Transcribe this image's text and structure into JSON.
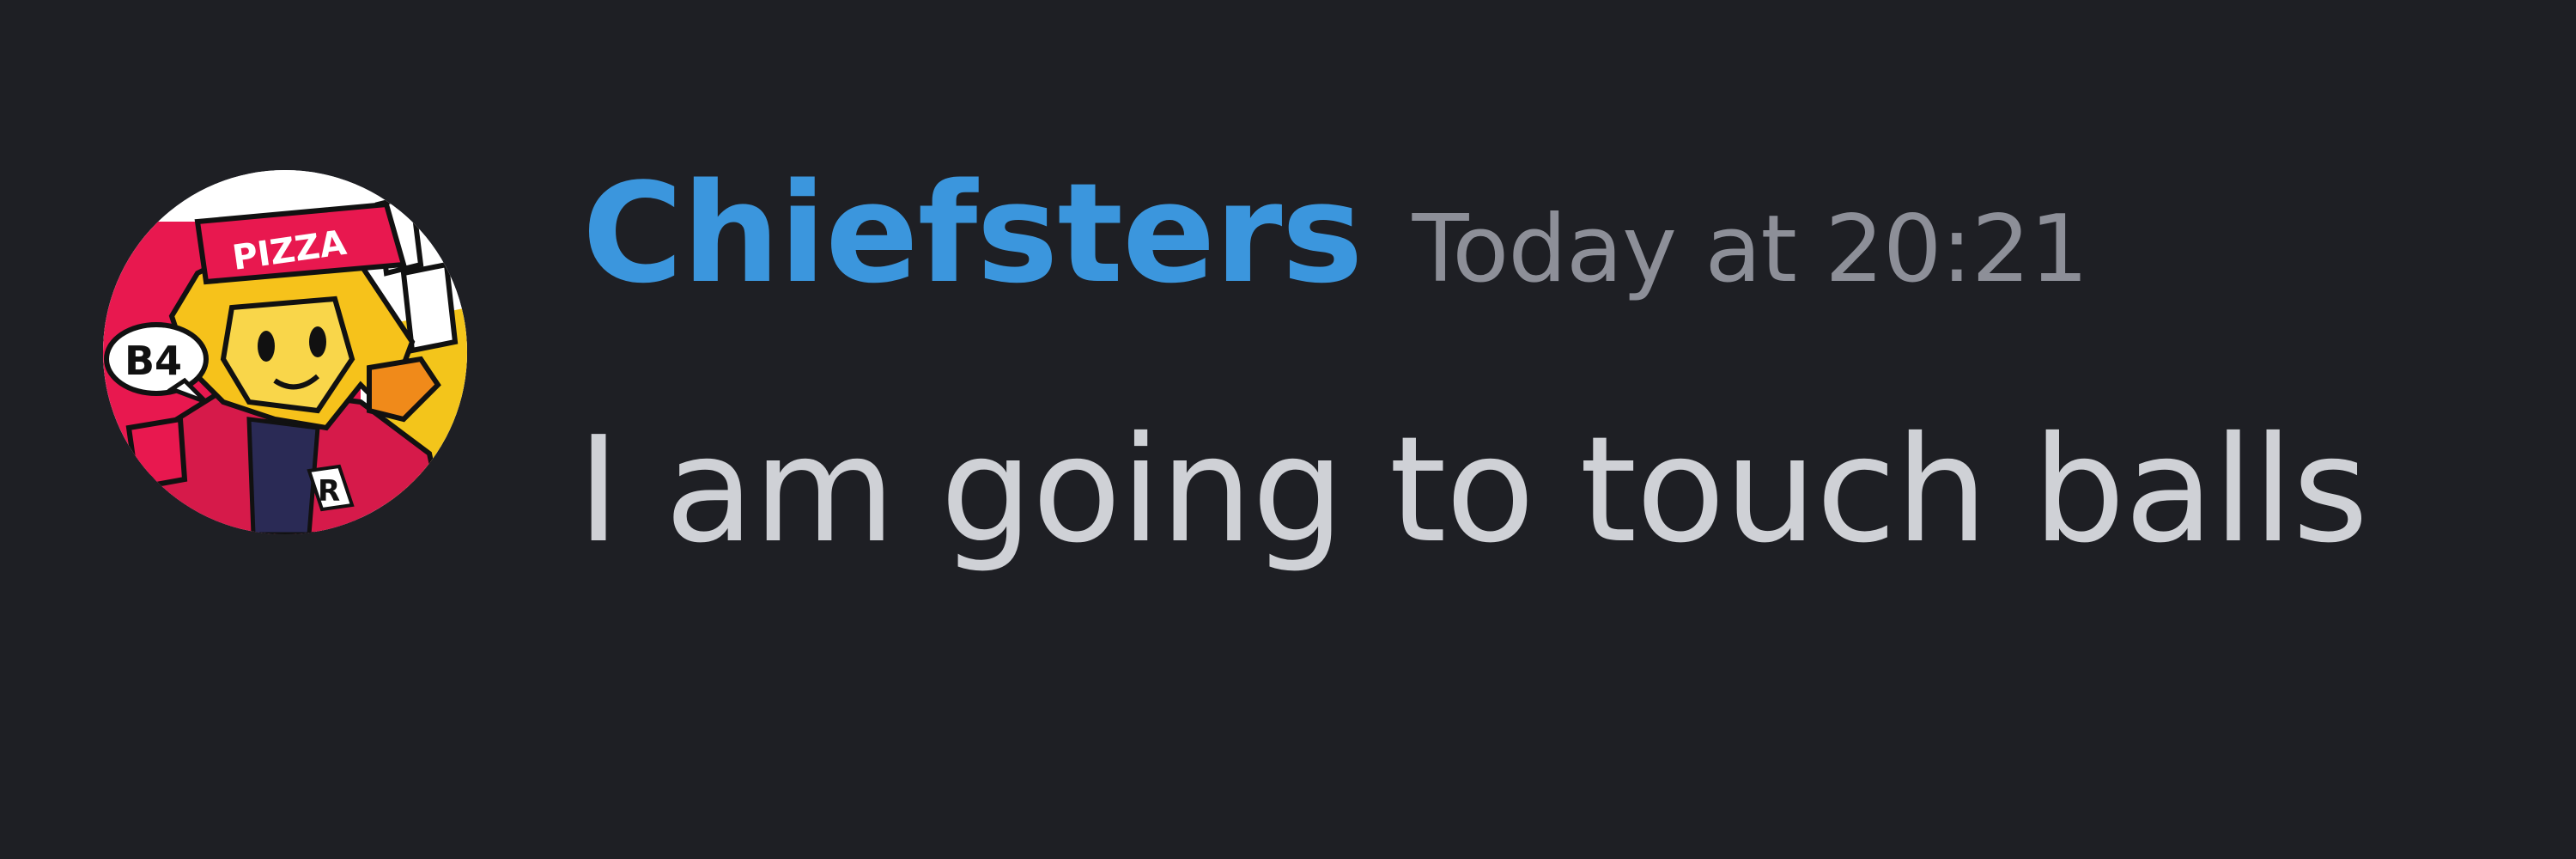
{
  "message": {
    "author": "Chiefsters",
    "timestamp": "Today at 20:21",
    "content": "I am going to touch balls",
    "author_color": "#3b96dd"
  },
  "avatar": {
    "icon": "user-avatar-pizza-character",
    "hat_text": "PIZZA",
    "bubble_text": "B4"
  }
}
